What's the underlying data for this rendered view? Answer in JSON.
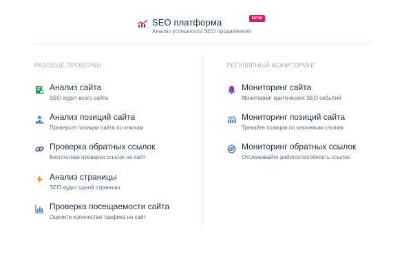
{
  "header": {
    "title": "SEO платформа",
    "badge": "NEW",
    "subtitle": "Анализ успешности SEO продвижения",
    "logo_icon": "chart-trend-icon",
    "accent": "#d81b60"
  },
  "left": {
    "title": "РАЗОВЫЕ ПРОВЕРКИ",
    "items": [
      {
        "name": "Анализ сайта",
        "desc": "SEO аудит всего сайта",
        "icon": "site-audit-icon",
        "color": "#2e9e57"
      },
      {
        "name": "Анализ позиций сайта",
        "desc": "Проверьте позиции сайта по ключам",
        "icon": "ranking-podium-icon",
        "color": "#3b6fd6"
      },
      {
        "name": "Проверка обратных ссылок",
        "desc": "Бесплатная проверка ссылок на сайт",
        "icon": "link-icon",
        "color": "#3a4e72"
      },
      {
        "name": "Анализ страницы",
        "desc": "SEO аудит одной страницы",
        "icon": "lightning-icon",
        "color": "#f08a24"
      },
      {
        "name": "Проверка посещаемости сайта",
        "desc": "Оцените количество трафика на сайт",
        "icon": "bar-chart-icon",
        "color": "#3b6fd6"
      }
    ]
  },
  "right": {
    "title": "РЕГУЛЯРНЫЙ МОНИТОРИНГ",
    "items": [
      {
        "name": "Мониторинг сайта",
        "desc": "Мониторинг критических SEO событий",
        "icon": "bell-icon",
        "color": "#8e3fc7"
      },
      {
        "name": "Мониторинг позиций сайта",
        "desc": "Трекайте позиции по ключевым словам",
        "icon": "chart-up-icon",
        "color": "#3b6fd6"
      },
      {
        "name": "Мониторинг обратных ссылок",
        "desc": "Отслеживайте работоспособность ссылок",
        "icon": "link-monitor-icon",
        "color": "#3b6fd6"
      }
    ]
  }
}
